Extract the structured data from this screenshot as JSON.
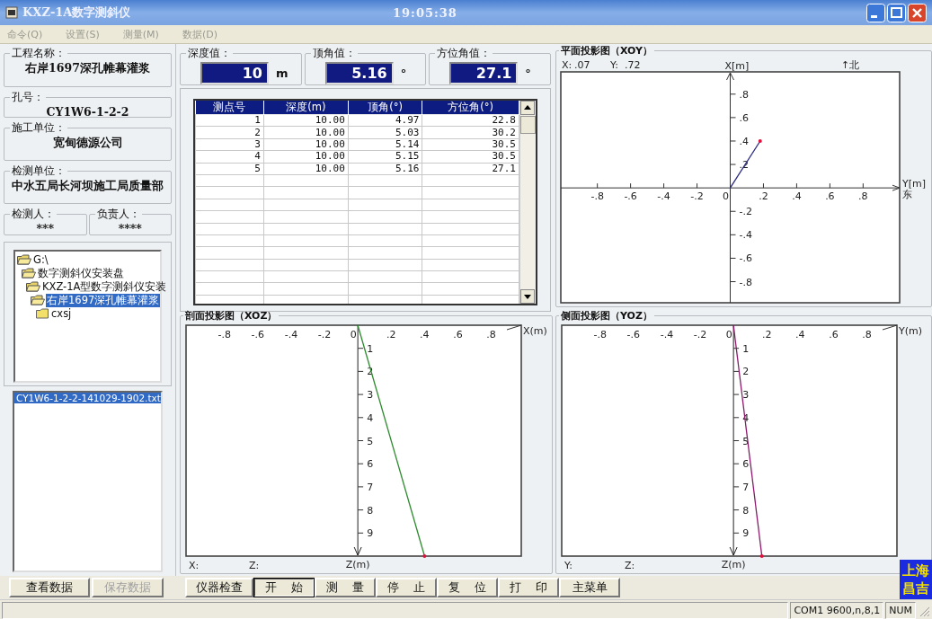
{
  "window": {
    "title": "KXZ-1A数字测斜仪",
    "time": "19:05:38"
  },
  "menu": [
    {
      "label": "命令(Q)",
      "disabled": true
    },
    {
      "label": "设置(S)",
      "disabled": true
    },
    {
      "label": "测量(M)",
      "disabled": true
    },
    {
      "label": "数据(D)",
      "disabled": true
    }
  ],
  "project": {
    "fields": [
      {
        "label": "工程名称：",
        "value": "右岸1697深孔帷幕灌浆"
      },
      {
        "label": "孔号：",
        "value": "CY1W6-1-2-2"
      },
      {
        "label": "施工单位：",
        "value": "宽甸德源公司"
      },
      {
        "label": "检测单位：",
        "value": "中水五局长河坝施工局质量部"
      }
    ],
    "people": [
      {
        "label": "检测人：",
        "value": "***"
      },
      {
        "label": "负责人：",
        "value": "****"
      }
    ]
  },
  "folder_tree": [
    {
      "label": "G:\\",
      "expanded": true,
      "selected": false,
      "children": [
        {
          "label": "数字测斜仪安装盘",
          "expanded": true,
          "selected": false,
          "children": [
            {
              "label": "KXZ-1A型数字测斜仪安装",
              "expanded": true,
              "selected": false,
              "children": [
                {
                  "label": "右岸1697深孔帷幕灌浆",
                  "expanded": true,
                  "selected": true,
                  "children": [
                    {
                      "label": "cxsj",
                      "expanded": false,
                      "selected": false
                    }
                  ]
                }
              ]
            }
          ]
        }
      ]
    }
  ],
  "files": [
    {
      "name": "CY1W6-1-2-2-141029-1902.txt",
      "selected": true
    }
  ],
  "readouts": [
    {
      "label": "深度值：",
      "value": "10",
      "unit": "m"
    },
    {
      "label": "顶角值：",
      "value": "5.16",
      "unit": "°"
    },
    {
      "label": "方位角值：",
      "value": "27.1",
      "unit": "°"
    }
  ],
  "table": {
    "columns": [
      "测点号",
      "深度(m)",
      "顶角(°)",
      "方位角(°)"
    ],
    "rows": [
      [
        "1",
        "10.00",
        "4.97",
        "22.8"
      ],
      [
        "2",
        "10.00",
        "5.03",
        "30.2"
      ],
      [
        "3",
        "10.00",
        "5.14",
        "30.5"
      ],
      [
        "4",
        "10.00",
        "5.15",
        "30.5"
      ],
      [
        "5",
        "10.00",
        "5.16",
        "27.1"
      ]
    ]
  },
  "charts": [
    {
      "kind": "plan",
      "readouts": [
        {
          "label": "X:",
          "value": ".07"
        },
        {
          "label": "Y:",
          "value": ".72"
        }
      ],
      "north_label": "↑北",
      "east_label": "东",
      "chart_data": {
        "type": "line",
        "title": "平面投影图（XOY）",
        "xlabel": "Y[m]",
        "ylabel": "X[m]",
        "x": [
          0,
          0.18
        ],
        "xlim": [
          -1.02,
          1.02
        ],
        "ylim": [
          -0.98,
          0.99
        ],
        "xticks": [
          {
            "value": -0.8,
            "label": "-.8"
          },
          {
            "value": -0.6,
            "label": "-.6"
          },
          {
            "value": -0.4,
            "label": "-.4"
          },
          {
            "value": -0.2,
            "label": "-.2"
          },
          {
            "value": 0,
            "label": "0"
          },
          {
            "value": 0.2,
            "label": ".2"
          },
          {
            "value": 0.4,
            "label": ".4"
          },
          {
            "value": 0.6,
            "label": ".6"
          },
          {
            "value": 0.8,
            "label": ".8"
          }
        ],
        "yticks": [
          {
            "value": 0.8,
            "label": ".8"
          },
          {
            "value": 0.6,
            "label": ".6"
          },
          {
            "value": 0.4,
            "label": ".4"
          },
          {
            "value": 0.2,
            "label": ".2"
          },
          {
            "value": -0.2,
            "label": "-.2"
          },
          {
            "value": -0.4,
            "label": "-.4"
          },
          {
            "value": -0.6,
            "label": "-.6"
          },
          {
            "value": -0.8,
            "label": "-.8"
          }
        ],
        "series": [
          {
            "color": "#2a2a80",
            "values": [
              0,
              0.4
            ]
          }
        ]
      }
    },
    {
      "kind": "profile",
      "readouts": [
        {
          "label": "X:"
        },
        {
          "label": "Z:"
        }
      ],
      "depth_axis_label": "Z(m)",
      "chart_data": {
        "type": "line",
        "title": "剖面投影图（XOZ）",
        "xlabel": "X(m)",
        "x": [
          0,
          0.4
        ],
        "xlim": [
          -1.03,
          0.98
        ],
        "ylim": [
          10,
          0
        ],
        "xticks": [
          {
            "value": -0.8,
            "label": "-.8"
          },
          {
            "value": -0.6,
            "label": "-.6"
          },
          {
            "value": -0.4,
            "label": "-.4"
          },
          {
            "value": -0.2,
            "label": "-.2"
          },
          {
            "value": 0,
            "label": "0"
          },
          {
            "value": 0.2,
            "label": ".2"
          },
          {
            "value": 0.4,
            "label": ".4"
          },
          {
            "value": 0.6,
            "label": ".6"
          },
          {
            "value": 0.8,
            "label": ".8"
          }
        ],
        "yticks": [
          1,
          2,
          3,
          4,
          5,
          6,
          7,
          8,
          9
        ],
        "series": [
          {
            "color": "#2e8b2e",
            "values": [
              0,
              10
            ]
          }
        ]
      }
    },
    {
      "kind": "profile",
      "readouts": [
        {
          "label": "Y:"
        },
        {
          "label": "Z:"
        }
      ],
      "depth_axis_label": "Z(m)",
      "chart_data": {
        "type": "line",
        "title": "侧面投影图（YOZ）",
        "xlabel": "Y(m)",
        "x": [
          0,
          0.17
        ],
        "xlim": [
          -1.03,
          0.98
        ],
        "ylim": [
          10,
          0
        ],
        "xticks": [
          {
            "value": -0.8,
            "label": "-.8"
          },
          {
            "value": -0.6,
            "label": "-.6"
          },
          {
            "value": -0.4,
            "label": "-.4"
          },
          {
            "value": -0.2,
            "label": "-.2"
          },
          {
            "value": 0,
            "label": "0"
          },
          {
            "value": 0.2,
            "label": ".2"
          },
          {
            "value": 0.4,
            "label": ".4"
          },
          {
            "value": 0.6,
            "label": ".6"
          },
          {
            "value": 0.8,
            "label": ".8"
          }
        ],
        "yticks": [
          1,
          2,
          3,
          4,
          5,
          6,
          7,
          8,
          9
        ],
        "series": [
          {
            "color": "#8b1a6b",
            "values": [
              0,
              10
            ]
          }
        ]
      }
    }
  ],
  "data_buttons": [
    {
      "label": "查看数据",
      "disabled": false
    },
    {
      "label": "保存数据",
      "disabled": true
    }
  ],
  "buttons": [
    {
      "label": "仪器检查",
      "default": false
    },
    {
      "label": "开 始",
      "default": true
    },
    {
      "label": "测 量",
      "default": false
    },
    {
      "label": "停 止",
      "default": false
    },
    {
      "label": "复 位",
      "default": false
    },
    {
      "label": "打 印",
      "default": false
    },
    {
      "label": "主菜单",
      "default": false
    }
  ],
  "logo": "上海昌吉",
  "status_bar": {
    "panels": [
      "COM1 9600,n,8,1",
      "NUM"
    ]
  }
}
